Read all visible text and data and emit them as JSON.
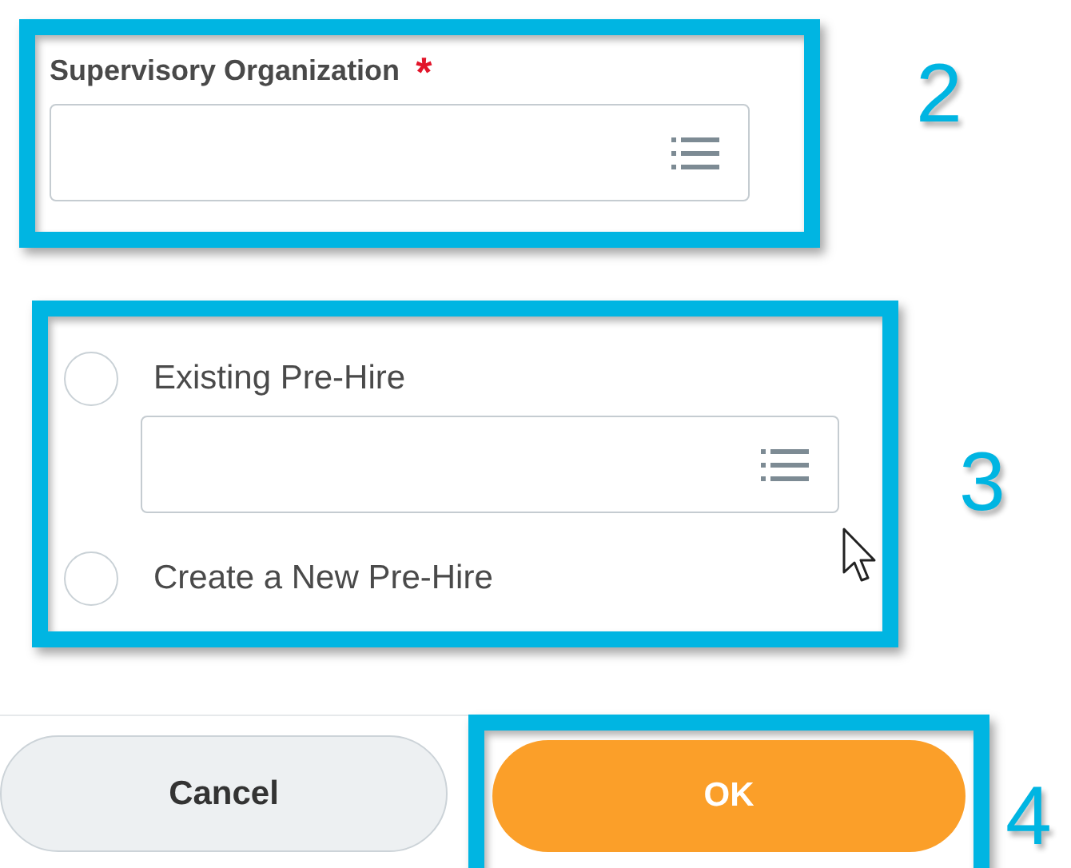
{
  "org_section": {
    "step": "2",
    "label": "Supervisory Organization",
    "required_mark": "*"
  },
  "pre_hire_section": {
    "step": "3",
    "options": [
      {
        "label": "Existing Pre-Hire",
        "selected": false,
        "has_field": true
      },
      {
        "label": "Create a New Pre-Hire",
        "selected": false,
        "has_field": false
      }
    ]
  },
  "buttons": [
    {
      "label": "Cancel",
      "kind": "secondary",
      "highlighted": false
    },
    {
      "label": "OK",
      "kind": "primary",
      "highlighted": true
    }
  ],
  "buttons_step": "4"
}
